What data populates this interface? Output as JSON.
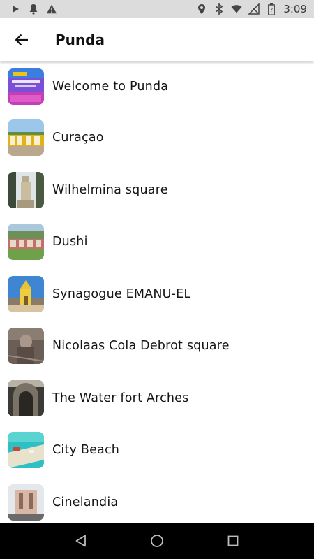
{
  "status_bar": {
    "time": "3:09",
    "icons": [
      "play-icon",
      "notification-bell-icon",
      "warning-icon",
      "location-icon",
      "bluetooth-icon",
      "wifi-icon",
      "no-signal-icon",
      "battery-icon"
    ]
  },
  "app_bar": {
    "title": "Punda",
    "back_icon": "arrow-back-icon"
  },
  "places": [
    {
      "label": "Welcome to Punda"
    },
    {
      "label": "Curaçao"
    },
    {
      "label": "Wilhelmina square"
    },
    {
      "label": "Dushi"
    },
    {
      "label": "Synagogue EMANU-EL"
    },
    {
      "label": "Nicolaas Cola Debrot square"
    },
    {
      "label": "The Water fort Arches"
    },
    {
      "label": "City Beach"
    },
    {
      "label": "Cinelandia"
    }
  ],
  "nav_bar": {
    "icons": [
      "back-triangle-icon",
      "home-circle-icon",
      "recents-square-icon"
    ]
  }
}
